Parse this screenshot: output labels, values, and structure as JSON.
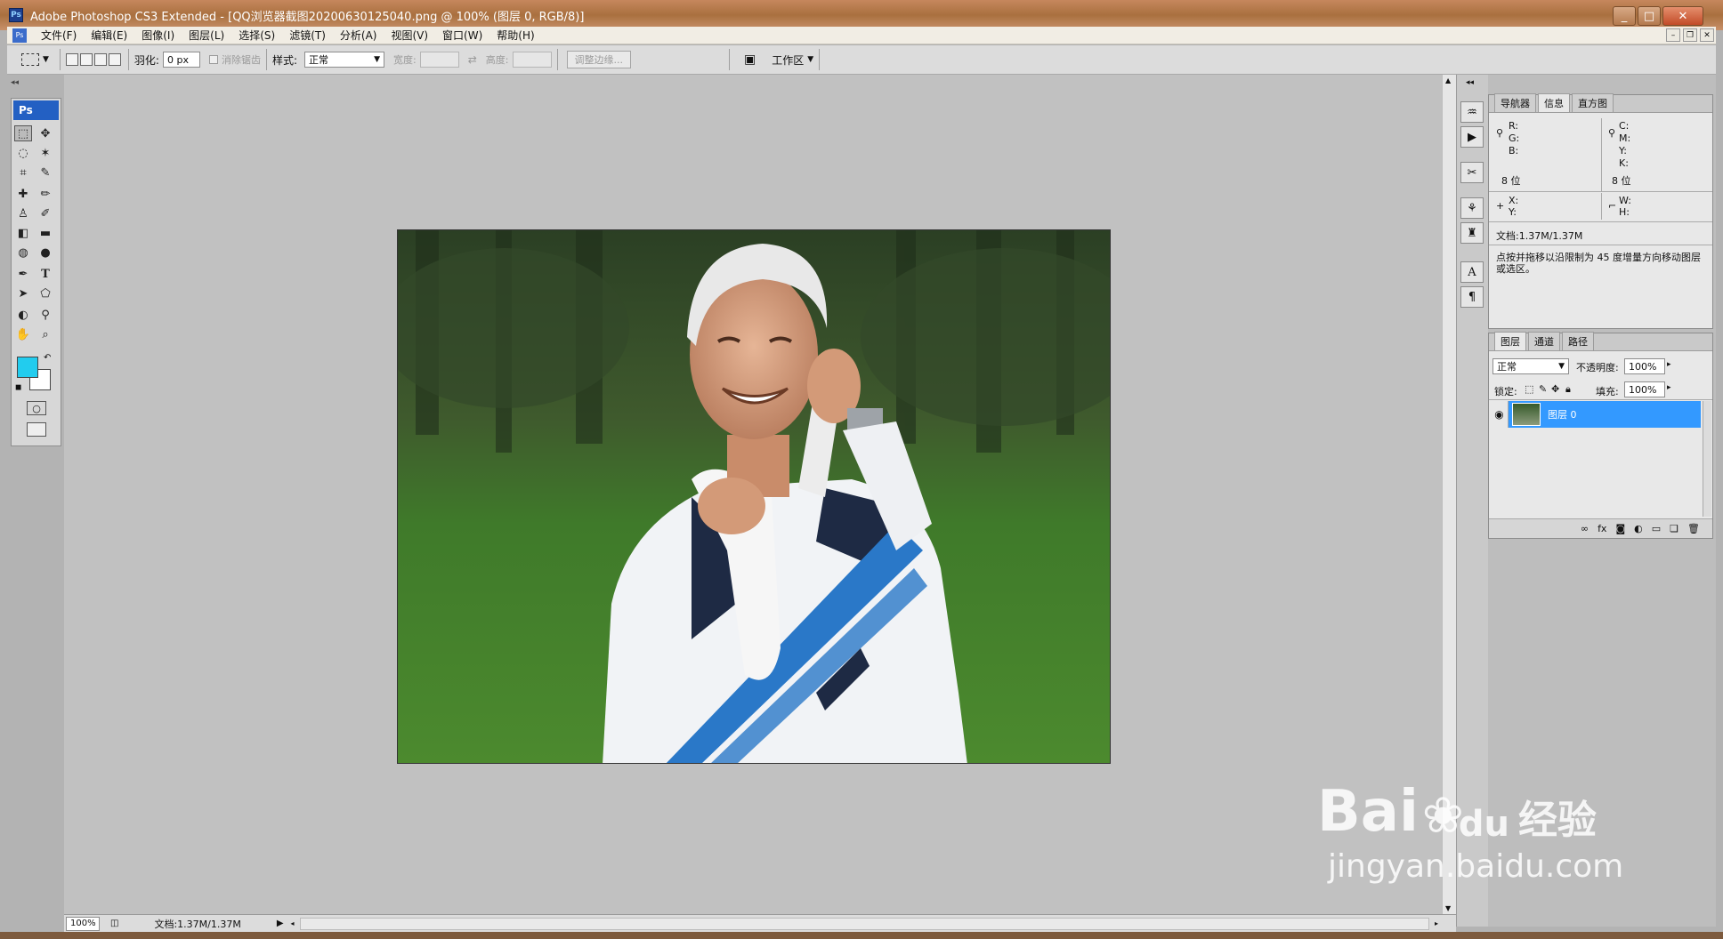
{
  "window": {
    "title": "Adobe Photoshop CS3 Extended - [QQ浏览器截图20200630125040.png @ 100% (图层 0, RGB/8)]",
    "controls": {
      "minimize": "_",
      "maximize": "□",
      "close": "✕"
    }
  },
  "menubar": {
    "app_icon": "Ps",
    "items": [
      "文件(F)",
      "编辑(E)",
      "图像(I)",
      "图层(L)",
      "选择(S)",
      "滤镜(T)",
      "分析(A)",
      "视图(V)",
      "窗口(W)",
      "帮助(H)"
    ]
  },
  "options": {
    "feather_label": "羽化:",
    "feather_value": "0 px",
    "antialias_label": "消除锯齿",
    "style_label": "样式:",
    "style_value": "正常",
    "width_label": "宽度:",
    "height_label": "高度:",
    "refine_edge": "调整边缘...",
    "workspace_label": "工作区"
  },
  "toolbox": {
    "title": "Ps",
    "foreground_color": "#22ccee",
    "background_color": "#ffffff"
  },
  "canvas": {
    "zoom": "100%",
    "doc_size": "文档:1.37M/1.37M"
  },
  "info_panel": {
    "tabs": [
      "导航器",
      "信息",
      "直方图"
    ],
    "active_tab": "信息",
    "rgb": [
      "R:",
      "G:",
      "B:"
    ],
    "cmyk": [
      "C:",
      "M:",
      "Y:",
      "K:"
    ],
    "bitdepth_left": "8 位",
    "bitdepth_right": "8 位",
    "xy": [
      "X:",
      "Y:"
    ],
    "wh": [
      "W:",
      "H:"
    ],
    "doc": "文档:1.37M/1.37M",
    "hint": "点按并拖移以沿限制为 45 度增量方向移动图层或选区。"
  },
  "layers_panel": {
    "tabs": [
      "图层",
      "通道",
      "路径"
    ],
    "active_tab": "图层",
    "blend_mode": "正常",
    "opacity_label": "不透明度:",
    "opacity_value": "100%",
    "lock_label": "锁定:",
    "fill_label": "填充:",
    "fill_value": "100%",
    "layers": [
      {
        "name": "图层 0",
        "visible": true,
        "selected": true
      }
    ]
  },
  "watermark": {
    "brand": "Bai",
    "brand_suffix": "du",
    "product": "经验",
    "url": "jingyan.baidu.com"
  },
  "colors": {
    "accent": "#3399ff",
    "titlebar": "#b47a4e",
    "toolbox_header": "#2360c3"
  }
}
